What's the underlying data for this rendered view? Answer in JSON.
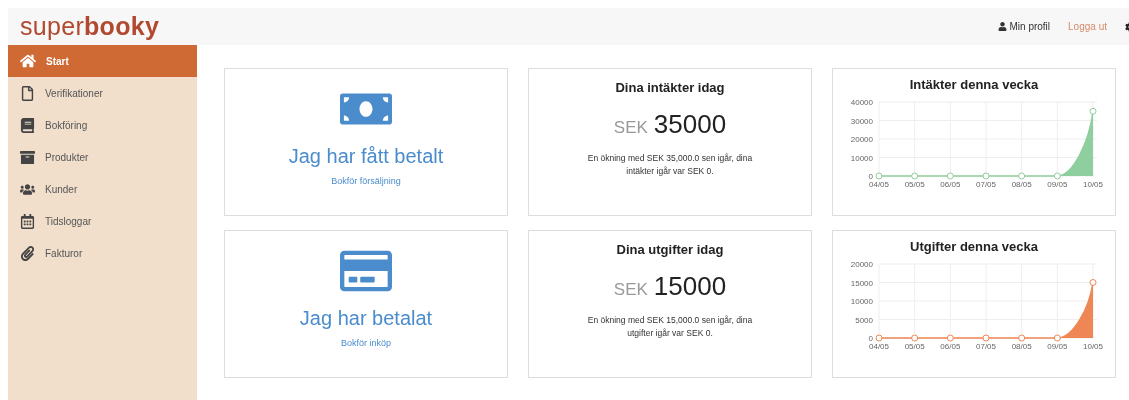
{
  "logo": "super**booky**",
  "header_links": [
    {
      "kind": "profile",
      "label": "Min profil"
    },
    {
      "kind": "logout",
      "label": "Logga ut"
    },
    {
      "kind": "settings"
    }
  ],
  "sidebar": {
    "items": [
      {
        "label": "Start",
        "selected": true
      },
      {
        "label": "Verifikationer",
        "selected": false
      },
      {
        "label": "Bokföring",
        "selected": false
      },
      {
        "label": "Produkter",
        "selected": false
      },
      {
        "label": "Kunder",
        "selected": false
      },
      {
        "label": "Tidsloggar",
        "selected": false
      },
      {
        "label": "Fakturor",
        "selected": false
      }
    ]
  },
  "rows": [
    {
      "action": {
        "kind": "bill",
        "title": "Jag har fått betalt",
        "link": "Bokför försäljning"
      },
      "stat": {
        "title": "Dina intäkter idag",
        "currency": "SEK",
        "amount": "35000",
        "description": "En ökning med SEK 35,000.0 sen igår, dina intäkter igår var SEK 0."
      },
      "chart": {
        "chart_data": {
          "type": "area",
          "title": "Intäkter denna vecka",
          "categories": [
            "04/05",
            "05/05",
            "06/05",
            "07/05",
            "08/05",
            "09/05",
            "10/05"
          ],
          "grid": true,
          "series": [
            {
              "color": "#8fcf9f",
              "values": [
                0,
                0,
                0,
                0,
                0,
                0,
                35000
              ]
            }
          ],
          "ylim": [
            0,
            40000
          ],
          "yticks": [
            0,
            10000,
            20000,
            30000,
            40000
          ]
        }
      }
    },
    {
      "action": {
        "kind": "card",
        "title": "Jag har betalat",
        "link": "Bokför inköp"
      },
      "stat": {
        "title": "Dina utgifter idag",
        "currency": "SEK",
        "amount": "15000",
        "description": "En ökning med SEK 15,000.0 sen igår, dina utgifter igår var SEK 0."
      },
      "chart": {
        "chart_data": {
          "type": "area",
          "title": "Utgifter denna vecka",
          "categories": [
            "04/05",
            "05/05",
            "06/05",
            "07/05",
            "08/05",
            "09/05",
            "10/05"
          ],
          "grid": true,
          "series": [
            {
              "color": "#ee8755",
              "values": [
                0,
                0,
                0,
                0,
                0,
                0,
                15000
              ]
            }
          ],
          "ylim": [
            0,
            20000
          ],
          "yticks": [
            0,
            5000,
            10000,
            15000,
            20000
          ]
        }
      }
    }
  ]
}
